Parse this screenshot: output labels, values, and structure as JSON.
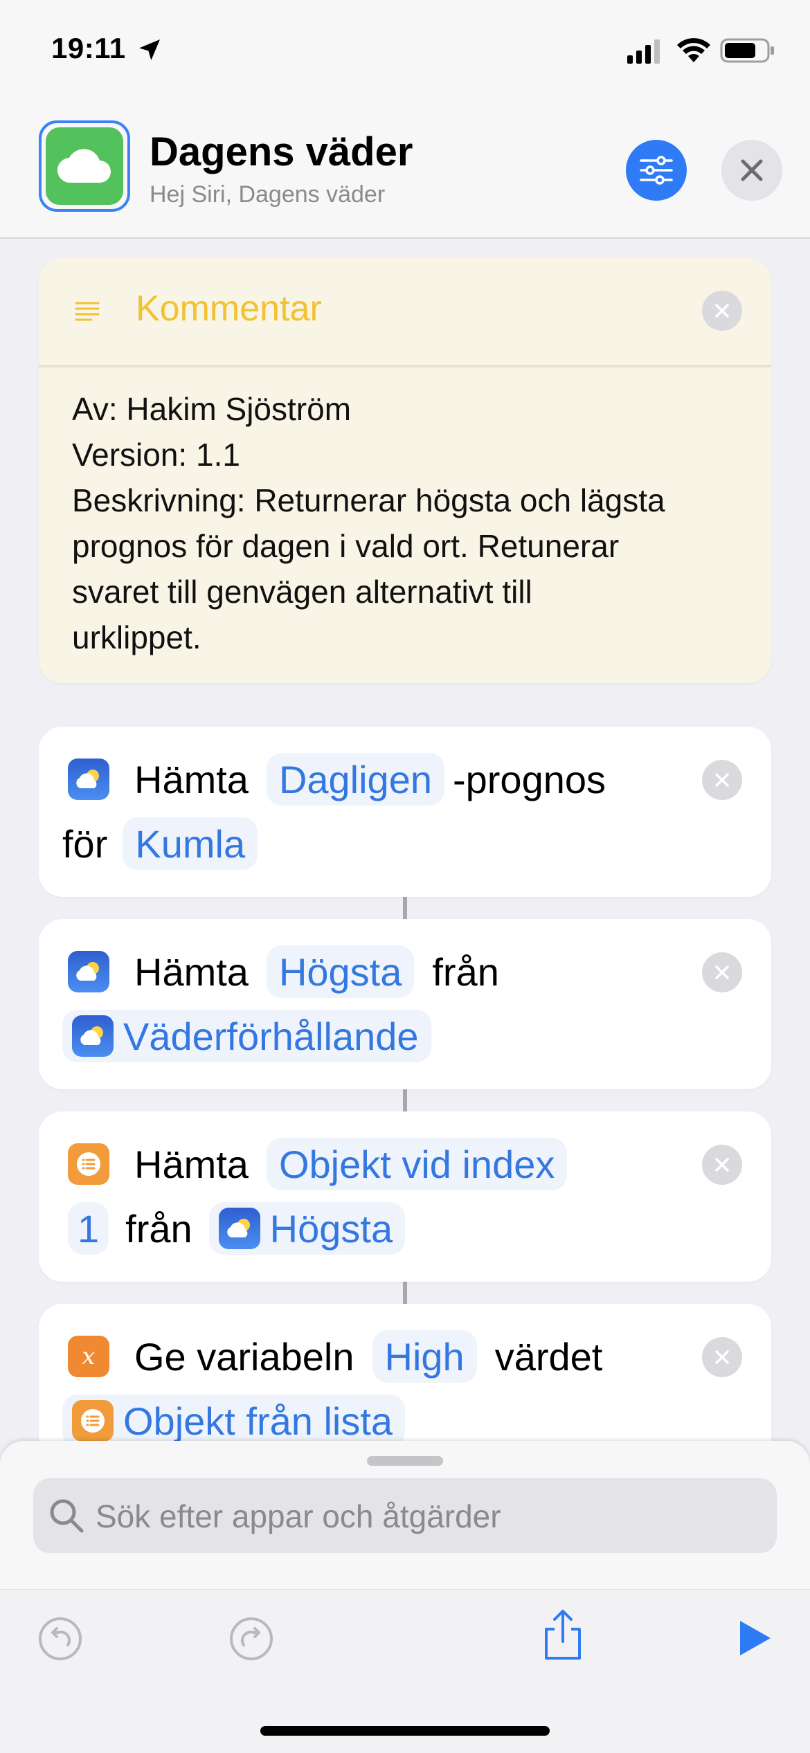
{
  "status": {
    "time": "19:11"
  },
  "header": {
    "title": "Dagens väder",
    "subtitle": "Hej Siri, Dagens väder"
  },
  "comment": {
    "title": "Kommentar",
    "lines": [
      "Av: Hakim Sjöström",
      "Version: 1.1",
      "Beskrivning: Returnerar högsta och lägsta",
      "prognos för dagen i vald ort. Retunerar",
      "svaret till genvägen alternativt till",
      "urklippet."
    ]
  },
  "actions": [
    {
      "verb": "Hämta",
      "param1": "Dagligen",
      "suffix": "-prognos",
      "word2": "för",
      "param2": "Kumla"
    },
    {
      "verb": "Hämta",
      "param1": "Högsta",
      "word1": "från",
      "param2": "Väderförhållande"
    },
    {
      "verb": "Hämta",
      "param1": "Objekt vid index",
      "param_index": "1",
      "word2": "från",
      "param2": "Högsta"
    },
    {
      "verb": "Ge variabeln",
      "param1": "High",
      "word1": "värdet",
      "param2": "Objekt från lista"
    }
  ],
  "search": {
    "placeholder": "Sök efter appar och åtgärder"
  },
  "colors": {
    "accent": "#2f7bf6",
    "comment_title": "#f1c232",
    "app_icon": "#53c15c"
  }
}
